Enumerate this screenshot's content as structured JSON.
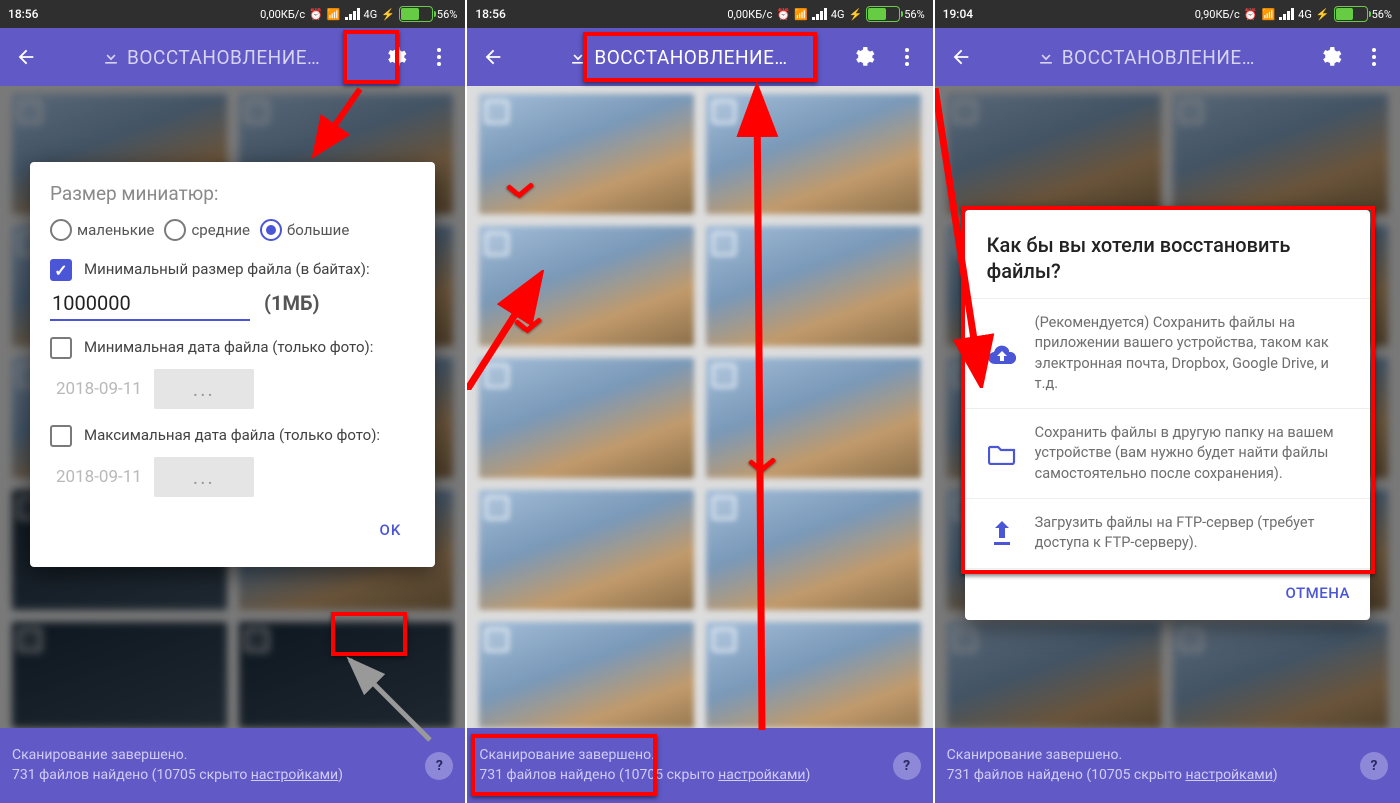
{
  "status": {
    "time1": "18:56",
    "time2": "18:56",
    "time3": "19:04",
    "net1": "0,00КБ/с",
    "net2": "0,00КБ/с",
    "net3": "0,90КБ/с",
    "sig": "4G",
    "charge": "⚡",
    "battery": "56%"
  },
  "app": {
    "title": "ВОССТАНОВЛЕНИЕ…"
  },
  "dialog_settings": {
    "title": "Размер миниатюр:",
    "radio_small": "маленькие",
    "radio_medium": "средние",
    "radio_large": "большие",
    "check_minsize": "Минимальный размер файла (в байтах):",
    "value_minsize": "1000000",
    "anno_1mb": "(1МБ)",
    "check_mindate": "Минимальная дата файла (только фото):",
    "date_placeholder": "2018-09-11",
    "date_btn": "...",
    "check_maxdate": "Максимальная дата файла (только фото):",
    "ok": "OK"
  },
  "dialog_restore": {
    "title": "Как бы вы хотели восстановить файлы?",
    "opt_cloud": "(Рекомендуется) Сохранить файлы на приложении вашего устройства, таком как электронная почта, Dropbox, Google Drive, и т.д.",
    "opt_folder": "Сохранить файлы в другую папку на вашем устройстве (вам нужно будет найти файлы самостоятельно после сохранения).",
    "opt_ftp": "Загрузить файлы на FTP-сервер (требует доступа к FTP-серверу).",
    "cancel": "ОТМЕНА"
  },
  "bottom": {
    "line1": "Сканирование завершено.",
    "line2_a": "731 файлов найдено",
    "line2_b": " (10705 скрыто ",
    "line2_c": "настройками",
    "line2_d": ")"
  }
}
